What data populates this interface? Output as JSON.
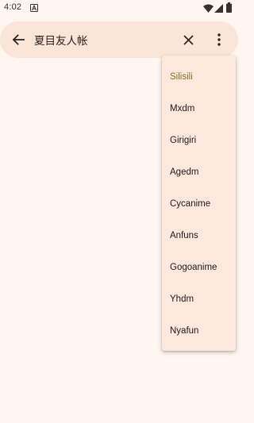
{
  "status_bar": {
    "time": "4:02",
    "notification_icon": "a-notification-icon",
    "wifi_icon": "wifi-icon",
    "cellular_icon": "cellular-signal-icon",
    "battery_icon": "battery-icon"
  },
  "search": {
    "value": "夏目友人帐",
    "back_icon": "arrow-left-icon",
    "clear_icon": "close-icon",
    "more_icon": "more-vert-icon"
  },
  "menu": {
    "selected": "Silisili",
    "items": [
      {
        "label": "Silisili"
      },
      {
        "label": "Mxdm"
      },
      {
        "label": "Girigiri"
      },
      {
        "label": "Agedm"
      },
      {
        "label": "Cycanime"
      },
      {
        "label": "Anfuns"
      },
      {
        "label": "Gogoanime"
      },
      {
        "label": "Yhdm"
      },
      {
        "label": "Nyafun"
      }
    ]
  },
  "colors": {
    "background": "#fff5f1",
    "search_bar": "#fbe4d8",
    "menu_background": "#fce8dc",
    "selected_text": "#8a6c1e",
    "text": "#1f1a17"
  }
}
